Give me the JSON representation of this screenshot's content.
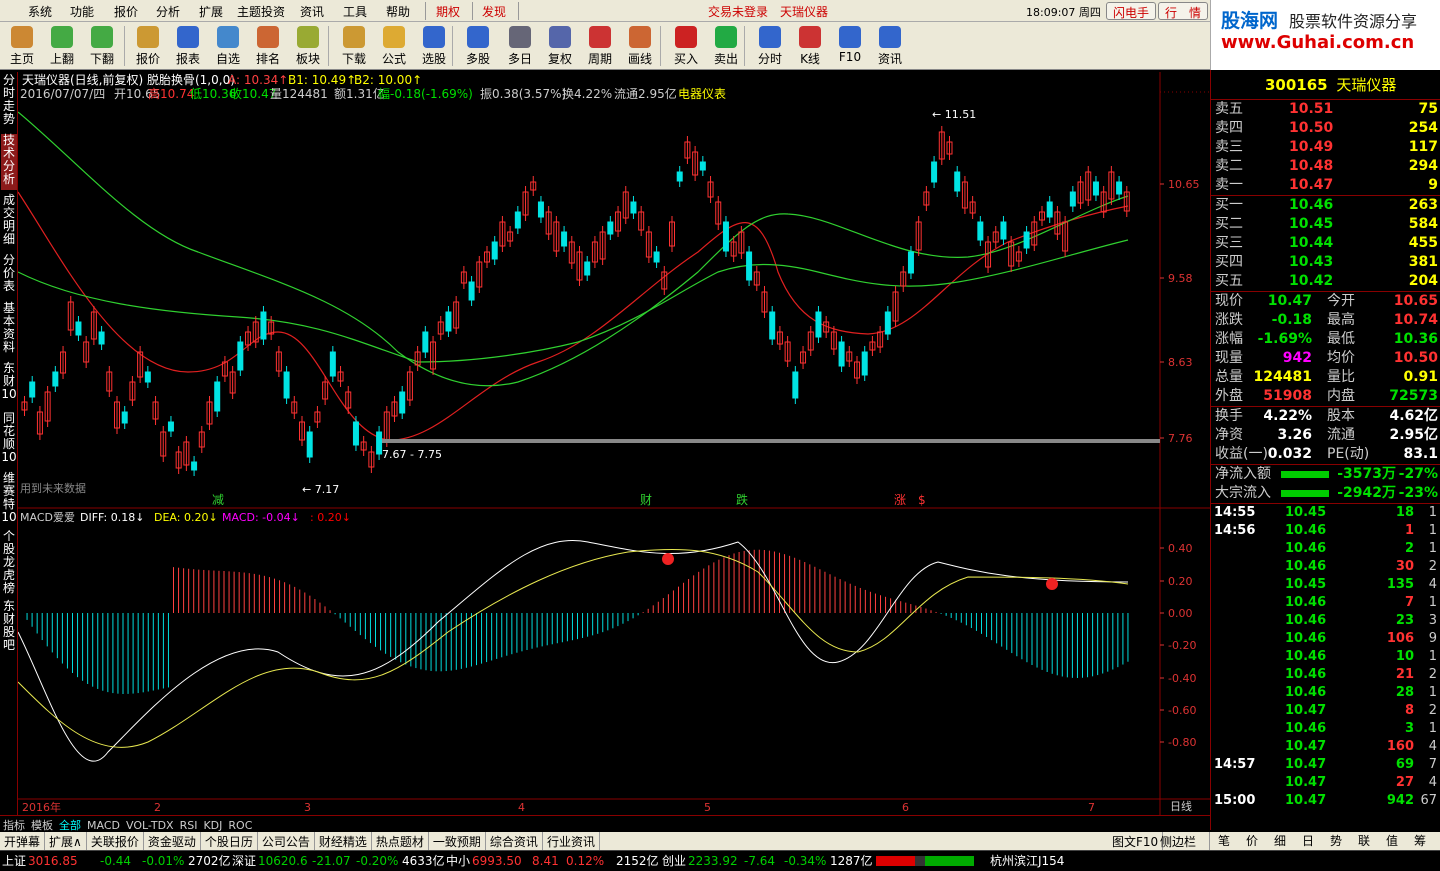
{
  "menu": [
    "系统",
    "功能",
    "报价",
    "分析",
    "扩展",
    "主题投资",
    "资讯",
    "工具",
    "帮助"
  ],
  "menu_red": [
    "期权",
    "发现"
  ],
  "login": "交易未登录",
  "stockname_top": "天瑞仪器",
  "clock": "18:09:07 周四",
  "btn_flash": "闪电手",
  "btn_quote": "行　情",
  "logo": {
    "l1": "股海网",
    "l2": "股票软件资源分享",
    "l3": "www.Guhai.com.cn"
  },
  "toolbar": [
    "主页",
    "上翻",
    "下翻",
    "报价",
    "报表",
    "自选",
    "排名",
    "板块",
    "下载",
    "公式",
    "选股",
    "多股",
    "多日",
    "复权",
    "周期",
    "画线",
    "买入",
    "卖出",
    "分时",
    "K线",
    "F10",
    "资讯"
  ],
  "lefttabs": [
    "分时走势",
    "技术分析",
    "成交明细",
    "分价表",
    "基本资料",
    "东财10",
    "同花顺10",
    "维赛特10",
    "个股龙虎榜",
    "东财股吧"
  ],
  "chart": {
    "title_line": "天瑞仪器(日线,前复权) 脱胎换骨(1,0,0)",
    "A": "A: 10.34↑",
    "B1": "B1: 10.49↑",
    "B2": "B2: 10.00↑",
    "date": "2016/07/07/四",
    "open": "开10.65",
    "high": "高10.74",
    "low": "低10.36",
    "close": "收10.47",
    "vol": "量124481",
    "amt": "额1.31亿",
    "chg": "幅-0.18(-1.69%)",
    "amp": "振0.38(3.57%)",
    "turn": "换4.22%",
    "float": "流通2.95亿",
    "industry": "电器仪表",
    "price_ticks": [
      "10.65",
      "9.58",
      "8.63",
      "7.76"
    ],
    "macd_ticks": [
      "0.40",
      "0.20",
      "0.00",
      "-0.20",
      "-0.40",
      "-0.60",
      "-0.80"
    ],
    "annot_high": "11.51",
    "annot_low": "7.17",
    "annot_range": "7.67 - 7.75",
    "future_text": "用到未来数据",
    "signals": [
      "减",
      "财",
      "跌",
      "涨",
      "$"
    ],
    "macd_title": "MACD爱爱",
    "diff": "DIFF: 0.18↓",
    "dea": "DEA: 0.20↓",
    "macd": "MACD: -0.04↓",
    "extra": ": 0.20↓",
    "x_labels": [
      "2016年",
      "2",
      "3",
      "4",
      "5",
      "6",
      "7"
    ],
    "period": "日线"
  },
  "quote": {
    "code": "300165",
    "name": "天瑞仪器",
    "asks": [
      [
        "卖五",
        "10.51",
        "75"
      ],
      [
        "卖四",
        "10.50",
        "254"
      ],
      [
        "卖三",
        "10.49",
        "117"
      ],
      [
        "卖二",
        "10.48",
        "294"
      ],
      [
        "卖一",
        "10.47",
        "9"
      ]
    ],
    "bids": [
      [
        "买一",
        "10.46",
        "263"
      ],
      [
        "买二",
        "10.45",
        "584"
      ],
      [
        "买三",
        "10.44",
        "455"
      ],
      [
        "买四",
        "10.43",
        "381"
      ],
      [
        "买五",
        "10.42",
        "204"
      ]
    ],
    "stats": [
      [
        "现价",
        "10.47",
        "今开",
        "10.65"
      ],
      [
        "涨跌",
        "-0.18",
        "最高",
        "10.74"
      ],
      [
        "涨幅",
        "-1.69%",
        "最低",
        "10.36"
      ],
      [
        "现量",
        "942",
        "均价",
        "10.50"
      ],
      [
        "总量",
        "124481",
        "量比",
        "0.91"
      ],
      [
        "外盘",
        "51908",
        "内盘",
        "72573"
      ]
    ],
    "stats2": [
      [
        "换手",
        "4.22%",
        "股本",
        "4.62亿"
      ],
      [
        "净资",
        "3.26",
        "流通",
        "2.95亿"
      ],
      [
        "收益(一)",
        "0.032",
        "PE(动)",
        "83.1"
      ]
    ],
    "flows": [
      [
        "净流入额",
        "-3573万",
        "-27%"
      ],
      [
        "大宗流入",
        "-2942万",
        "-23%"
      ]
    ],
    "ticks": [
      [
        "14:55",
        "10.45",
        "18",
        "1"
      ],
      [
        "14:56",
        "10.46",
        "1",
        "1"
      ],
      [
        "",
        "10.46",
        "2",
        "1"
      ],
      [
        "",
        "10.46",
        "30",
        "2"
      ],
      [
        "",
        "10.45",
        "135",
        "4"
      ],
      [
        "",
        "10.46",
        "7",
        "1"
      ],
      [
        "",
        "10.46",
        "23",
        "3"
      ],
      [
        "",
        "10.46",
        "106",
        "9"
      ],
      [
        "",
        "10.46",
        "10",
        "1"
      ],
      [
        "",
        "10.46",
        "21",
        "2"
      ],
      [
        "",
        "10.46",
        "28",
        "1"
      ],
      [
        "",
        "10.47",
        "8",
        "2"
      ],
      [
        "",
        "10.46",
        "3",
        "1"
      ],
      [
        "",
        "10.47",
        "160",
        "4"
      ],
      [
        "14:57",
        "10.47",
        "69",
        "7"
      ],
      [
        "",
        "10.47",
        "27",
        "4"
      ],
      [
        "15:00",
        "10.47",
        "942",
        "67"
      ]
    ]
  },
  "bottom_tabs": [
    "指标",
    "模板",
    "全部",
    "MACD",
    "VOL-TDX",
    "RSI",
    "KDJ",
    "ROC"
  ],
  "section_tabs": [
    "开弹幕",
    "扩展∧",
    "关联报价",
    "资金驱动",
    "个股日历",
    "公司公告",
    "财经精选",
    "热点题材",
    "一致预期",
    "综合资讯",
    "行业资讯"
  ],
  "section_right": [
    "图文F10",
    "侧边栏<"
  ],
  "right_tabs": [
    "笔",
    "价",
    "细",
    "日",
    "势",
    "联",
    "值",
    "筹"
  ],
  "status": {
    "sh_name": "上证",
    "sh": "3016.85",
    "sh_chg": "-0.44",
    "sh_pct": "-0.01%",
    "sh_amt": "2702亿",
    "sz_name": "深证",
    "sz": "10620.6",
    "sz_chg": "-21.07",
    "sz_pct": "-0.20%",
    "sz_amt": "4633亿",
    "zx_name": "中小",
    "zx": "6993.50",
    "zx_chg": "8.41",
    "zx_pct": "0.12%",
    "zx_amt": "2152亿",
    "cy_name": "创业",
    "cy": "2233.92",
    "cy_chg": "-7.64",
    "cy_pct": "-0.34%",
    "cy_amt": "1287亿",
    "server": "杭州滨江J154"
  },
  "colors": {
    "up": "#ff3232",
    "down": "#00e4e4",
    "ma_red": "#e02020",
    "ma_green": "#30d030",
    "macd_white": "#ffffff",
    "macd_yellow": "#e8e850"
  }
}
